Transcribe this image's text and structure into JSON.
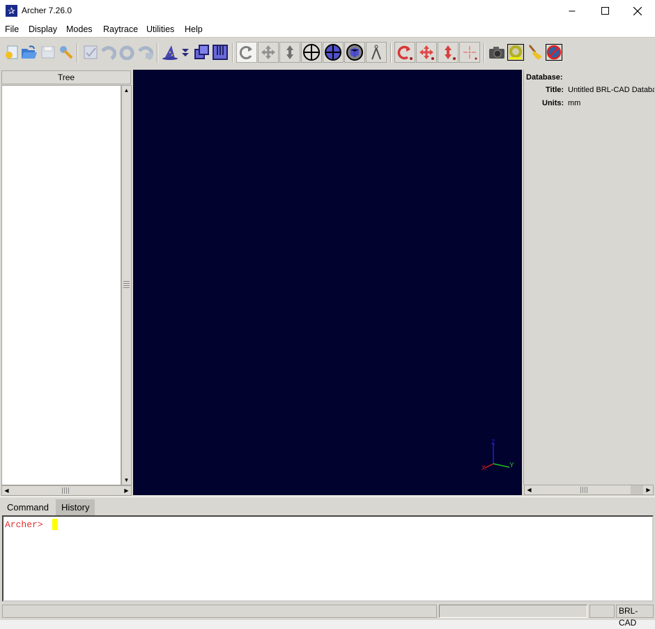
{
  "window": {
    "title": "Archer 7.26.0",
    "minimize_glyph": "–",
    "maximize_glyph": "☐",
    "close_glyph": "✕"
  },
  "menu": [
    "File",
    "Display",
    "Modes",
    "Raytrace",
    "Utilities",
    "Help"
  ],
  "toolbar": {
    "file_group": [
      "new-database-icon",
      "open-database-icon",
      "save-database-icon",
      "preferences-wrench-icon"
    ],
    "edit_group": [
      "checkpoint-icon",
      "undo-icon",
      "revert-icon",
      "revert-all-icon"
    ],
    "wizard_group": [
      "wizard-hat-icon",
      "wizard-dropdown-icon",
      "view-overlap-icon",
      "view-columns-icon"
    ],
    "view_modes": [
      "rotate-view",
      "translate-view",
      "scale-view",
      "center-view",
      "center-component",
      "component-select",
      "measure-tool"
    ],
    "edit_modes": [
      "rotate-object",
      "translate-object",
      "scale-object",
      "center-object"
    ],
    "raytrace_group": [
      "raytrace-camera-icon",
      "raytrace-control-icon",
      "clear-broom-icon",
      "abort-raytrace-icon"
    ]
  },
  "tree": {
    "header": "Tree"
  },
  "info": {
    "database_label": "Database:",
    "title_label": "Title:",
    "title_value": "Untitled BRL-CAD Database",
    "units_label": "Units:",
    "units_value": "mm"
  },
  "axes": {
    "x_label": "X",
    "y_label": "Y",
    "z_label": "Z"
  },
  "command": {
    "tabs": [
      "Command",
      "History"
    ],
    "active_tab": "Command",
    "prompt": "Archer>",
    "input_value": ""
  },
  "status": {
    "main": "",
    "progress": "",
    "small": "",
    "label": "BRL-CAD"
  },
  "colors": {
    "viewport_bg": "#02022e",
    "prompt": "#e03030",
    "cursor": "#ffff00",
    "edit_mode_red": "#e04040",
    "toolbar_bg": "#d9d7d1"
  }
}
